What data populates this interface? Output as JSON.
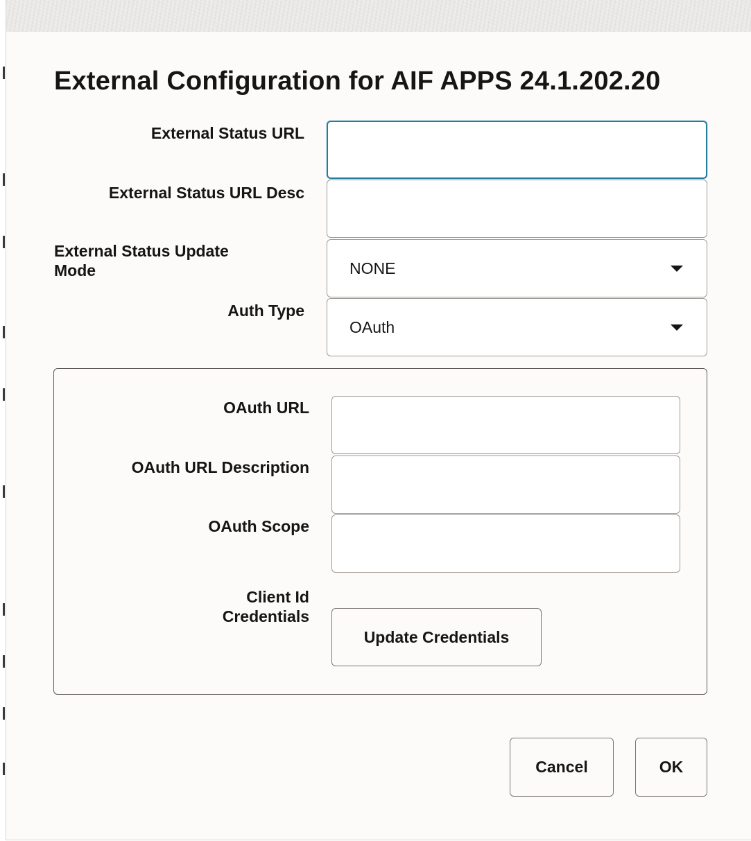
{
  "dialog": {
    "title": "External Configuration for AIF APPS 24.1.202.20"
  },
  "form": {
    "external_status_url": {
      "label": "External Status URL",
      "value": ""
    },
    "external_status_url_desc": {
      "label": "External Status URL Desc",
      "value": ""
    },
    "external_status_update_mode": {
      "label_line1": "External Status Update",
      "label_line2": "Mode",
      "selected": "NONE",
      "icon": "chevron-down-icon"
    },
    "auth_type": {
      "label": "Auth Type",
      "selected": "OAuth",
      "icon": "chevron-down-icon"
    }
  },
  "oauth": {
    "oauth_url": {
      "label": "OAuth URL",
      "value": ""
    },
    "oauth_url_description": {
      "label": "OAuth URL Description",
      "value": ""
    },
    "oauth_scope": {
      "label": "OAuth Scope",
      "value": ""
    },
    "client_id_credentials": {
      "label_line1": "Client Id",
      "label_line2": "Credentials",
      "button_label": "Update Credentials"
    }
  },
  "footer": {
    "cancel_label": "Cancel",
    "ok_label": "OK"
  },
  "colors": {
    "focus_border": "#227e9e",
    "dialog_background": "#fcfbfa",
    "text": "#161513"
  }
}
